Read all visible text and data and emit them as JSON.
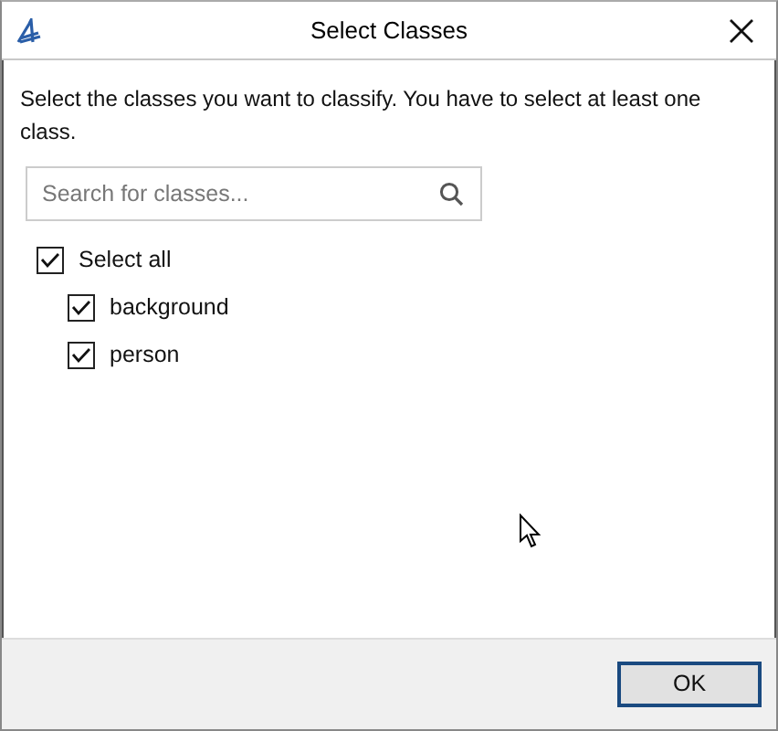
{
  "window": {
    "title": "Select Classes"
  },
  "instructions": "Select the classes you want to classify. You have to select at least one class.",
  "search": {
    "placeholder": "Search for classes..."
  },
  "tree": [
    {
      "label": "Select all",
      "checked": true,
      "children": [
        {
          "label": "background",
          "checked": true
        },
        {
          "label": "person",
          "checked": true
        }
      ]
    }
  ],
  "buttons": [
    {
      "label": "OK",
      "kind": "default"
    }
  ]
}
